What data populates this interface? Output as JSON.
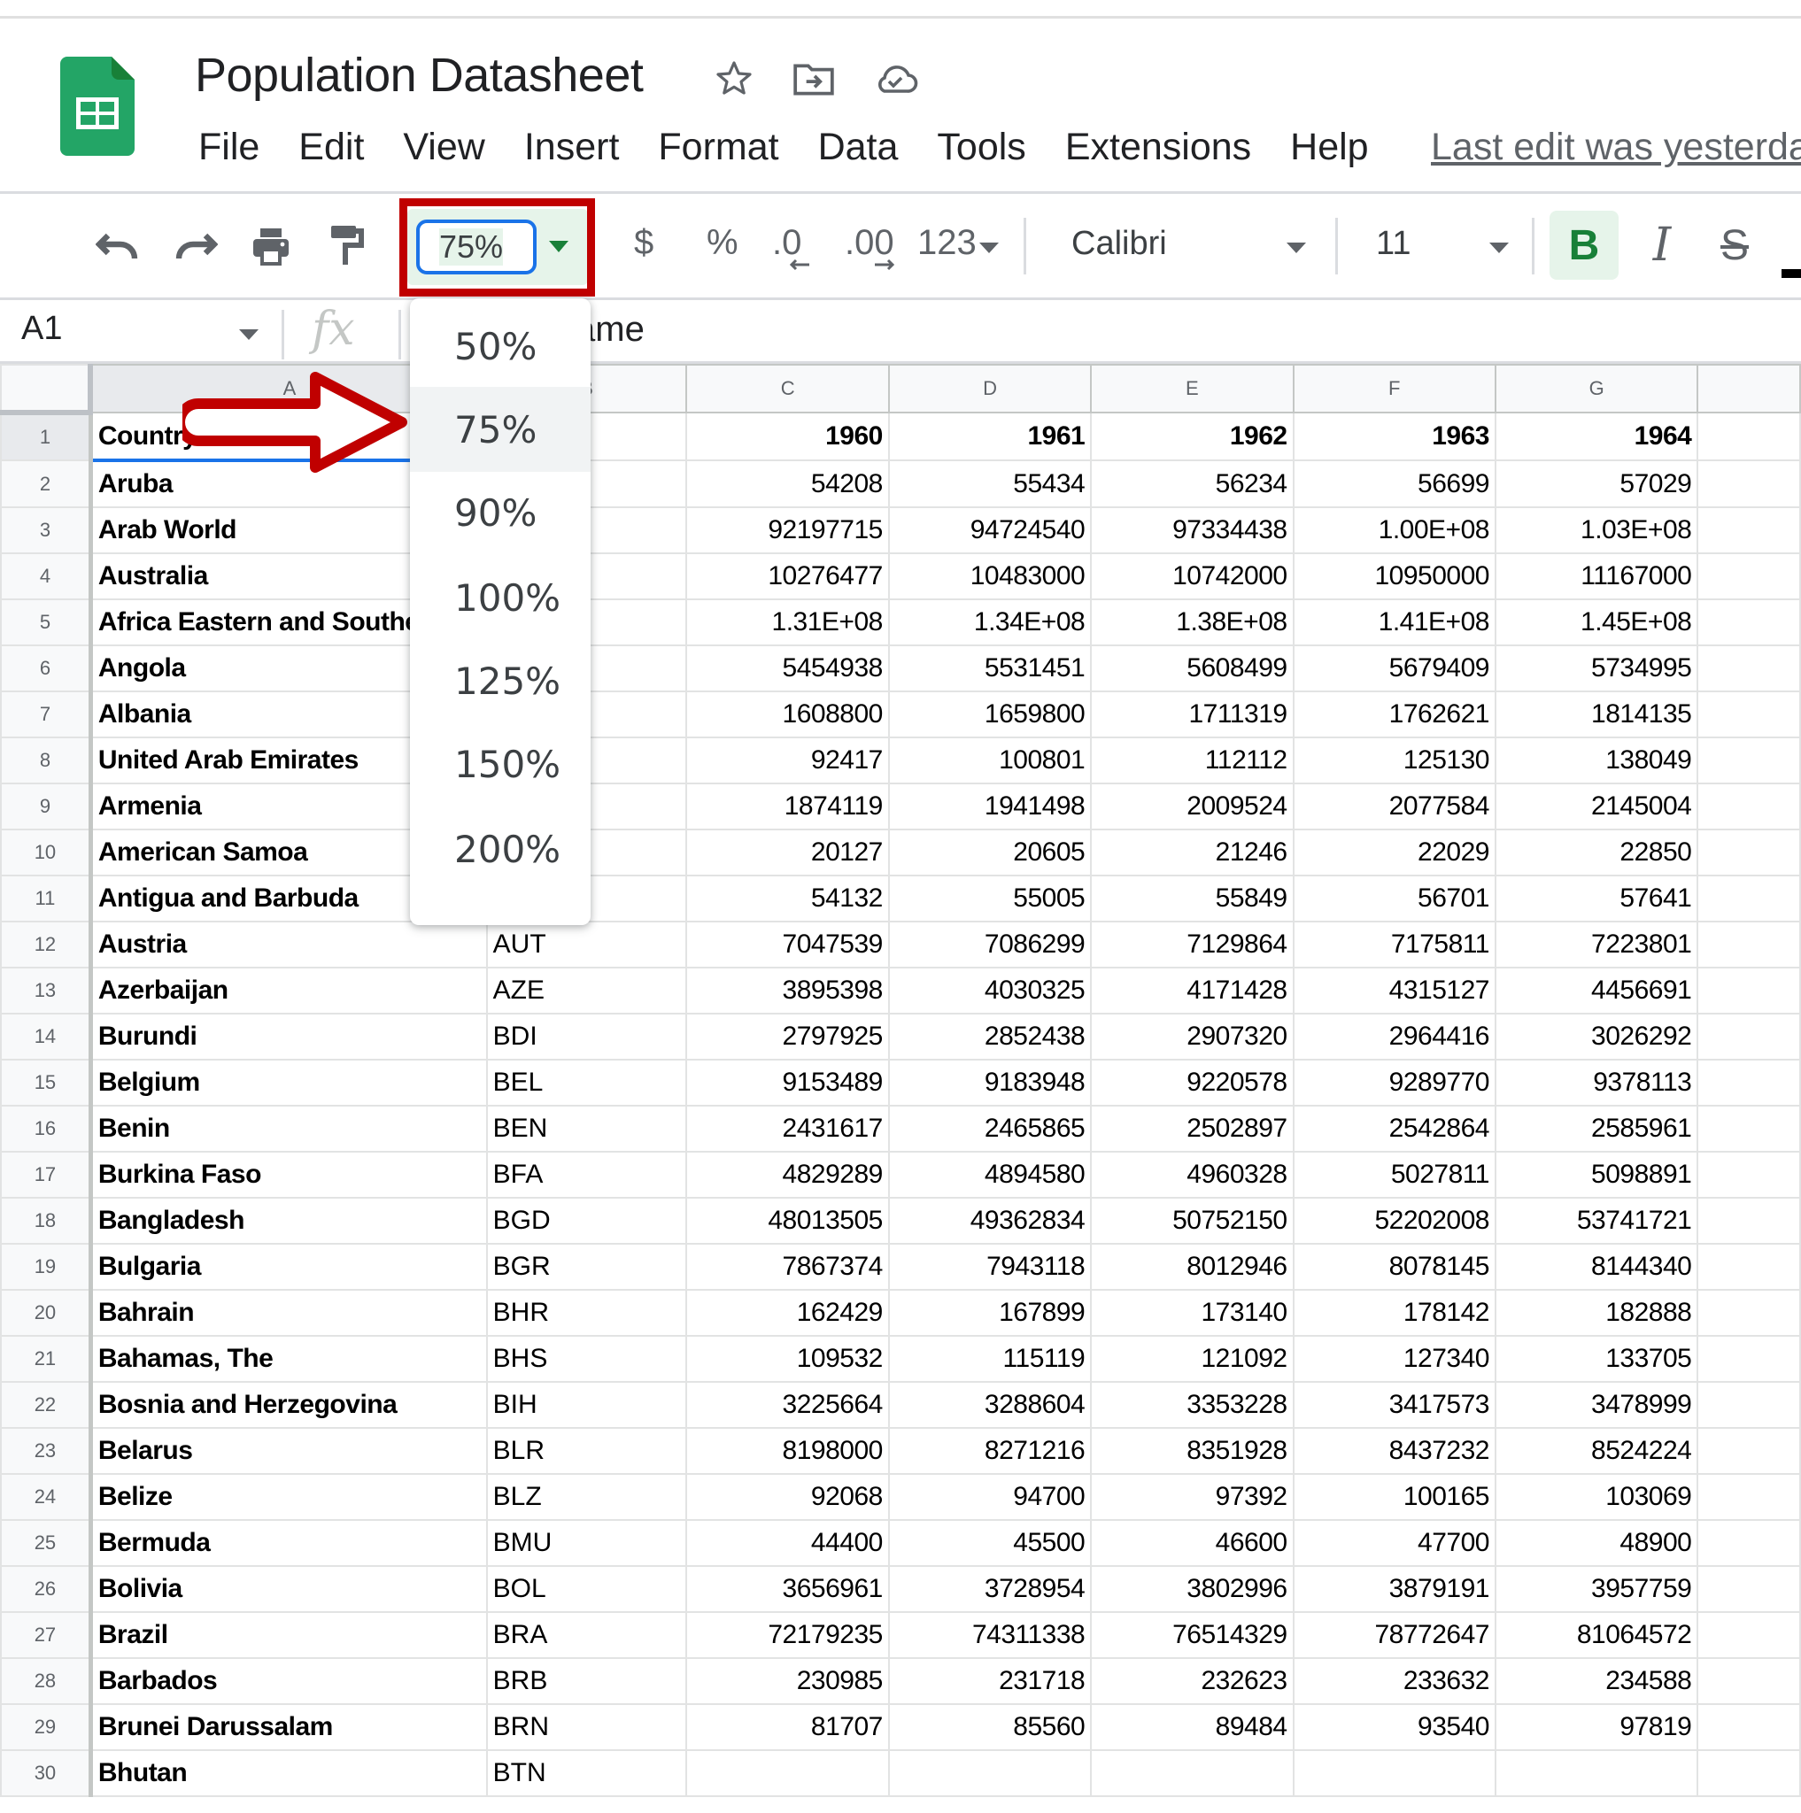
{
  "app": {
    "title": "Population Datasheet",
    "menu": [
      "File",
      "Edit",
      "View",
      "Insert",
      "Format",
      "Data",
      "Tools",
      "Extensions",
      "Help"
    ],
    "last_edit": "Last edit was yesterday"
  },
  "toolbar": {
    "zoom_value": "75%",
    "currency": "$",
    "percent": "%",
    "decrease_decimal": ".0",
    "increase_decimal": ".00",
    "number_format": "123",
    "font": "Calibri",
    "font_size": "11",
    "bold": "B",
    "italic": "I",
    "strikethrough": "S",
    "icons": [
      "undo-icon",
      "redo-icon",
      "print-icon",
      "paint-format-icon"
    ]
  },
  "formula_bar": {
    "cell_ref": "A1",
    "fx": "fx",
    "content": "Country Name"
  },
  "zoom_menu": {
    "options": [
      "50%",
      "75%",
      "90%",
      "100%",
      "125%",
      "150%",
      "200%"
    ],
    "selected": "75%"
  },
  "grid": {
    "columns": [
      "A",
      "B",
      "C",
      "D",
      "E",
      "F",
      "G",
      ""
    ],
    "rows": [
      {
        "n": "1",
        "name": "Country Name",
        "code": "",
        "v": [
          "1960",
          "1961",
          "1962",
          "1963",
          "1964"
        ]
      },
      {
        "n": "2",
        "name": "Aruba",
        "code": "",
        "v": [
          "54208",
          "55434",
          "56234",
          "56699",
          "57029"
        ]
      },
      {
        "n": "3",
        "name": "Arab World",
        "code": "",
        "v": [
          "92197715",
          "94724540",
          "97334438",
          "1.00E+08",
          "1.03E+08"
        ]
      },
      {
        "n": "4",
        "name": "Australia",
        "code": "",
        "v": [
          "10276477",
          "10483000",
          "10742000",
          "10950000",
          "11167000"
        ]
      },
      {
        "n": "5",
        "name": "Africa Eastern and Southern",
        "code": "",
        "v": [
          "1.31E+08",
          "1.34E+08",
          "1.38E+08",
          "1.41E+08",
          "1.45E+08"
        ]
      },
      {
        "n": "6",
        "name": "Angola",
        "code": "",
        "v": [
          "5454938",
          "5531451",
          "5608499",
          "5679409",
          "5734995"
        ]
      },
      {
        "n": "7",
        "name": "Albania",
        "code": "",
        "v": [
          "1608800",
          "1659800",
          "1711319",
          "1762621",
          "1814135"
        ]
      },
      {
        "n": "8",
        "name": "United Arab Emirates",
        "code": "",
        "v": [
          "92417",
          "100801",
          "112112",
          "125130",
          "138049"
        ]
      },
      {
        "n": "9",
        "name": "Armenia",
        "code": "",
        "v": [
          "1874119",
          "1941498",
          "2009524",
          "2077584",
          "2145004"
        ]
      },
      {
        "n": "10",
        "name": "American Samoa",
        "code": "",
        "v": [
          "20127",
          "20605",
          "21246",
          "22029",
          "22850"
        ]
      },
      {
        "n": "11",
        "name": "Antigua and Barbuda",
        "code": "",
        "v": [
          "54132",
          "55005",
          "55849",
          "56701",
          "57641"
        ]
      },
      {
        "n": "12",
        "name": "Austria",
        "code": "AUT",
        "v": [
          "7047539",
          "7086299",
          "7129864",
          "7175811",
          "7223801"
        ]
      },
      {
        "n": "13",
        "name": "Azerbaijan",
        "code": "AZE",
        "v": [
          "3895398",
          "4030325",
          "4171428",
          "4315127",
          "4456691"
        ]
      },
      {
        "n": "14",
        "name": "Burundi",
        "code": "BDI",
        "v": [
          "2797925",
          "2852438",
          "2907320",
          "2964416",
          "3026292"
        ]
      },
      {
        "n": "15",
        "name": "Belgium",
        "code": "BEL",
        "v": [
          "9153489",
          "9183948",
          "9220578",
          "9289770",
          "9378113"
        ]
      },
      {
        "n": "16",
        "name": "Benin",
        "code": "BEN",
        "v": [
          "2431617",
          "2465865",
          "2502897",
          "2542864",
          "2585961"
        ]
      },
      {
        "n": "17",
        "name": "Burkina Faso",
        "code": "BFA",
        "v": [
          "4829289",
          "4894580",
          "4960328",
          "5027811",
          "5098891"
        ]
      },
      {
        "n": "18",
        "name": "Bangladesh",
        "code": "BGD",
        "v": [
          "48013505",
          "49362834",
          "50752150",
          "52202008",
          "53741721"
        ]
      },
      {
        "n": "19",
        "name": "Bulgaria",
        "code": "BGR",
        "v": [
          "7867374",
          "7943118",
          "8012946",
          "8078145",
          "8144340"
        ]
      },
      {
        "n": "20",
        "name": "Bahrain",
        "code": "BHR",
        "v": [
          "162429",
          "167899",
          "173140",
          "178142",
          "182888"
        ]
      },
      {
        "n": "21",
        "name": "Bahamas, The",
        "code": "BHS",
        "v": [
          "109532",
          "115119",
          "121092",
          "127340",
          "133705"
        ]
      },
      {
        "n": "22",
        "name": "Bosnia and Herzegovina",
        "code": "BIH",
        "v": [
          "3225664",
          "3288604",
          "3353228",
          "3417573",
          "3478999"
        ]
      },
      {
        "n": "23",
        "name": "Belarus",
        "code": "BLR",
        "v": [
          "8198000",
          "8271216",
          "8351928",
          "8437232",
          "8524224"
        ]
      },
      {
        "n": "24",
        "name": "Belize",
        "code": "BLZ",
        "v": [
          "92068",
          "94700",
          "97392",
          "100165",
          "103069"
        ]
      },
      {
        "n": "25",
        "name": "Bermuda",
        "code": "BMU",
        "v": [
          "44400",
          "45500",
          "46600",
          "47700",
          "48900"
        ]
      },
      {
        "n": "26",
        "name": "Bolivia",
        "code": "BOL",
        "v": [
          "3656961",
          "3728954",
          "3802996",
          "3879191",
          "3957759"
        ]
      },
      {
        "n": "27",
        "name": "Brazil",
        "code": "BRA",
        "v": [
          "72179235",
          "74311338",
          "76514329",
          "78772647",
          "81064572"
        ]
      },
      {
        "n": "28",
        "name": "Barbados",
        "code": "BRB",
        "v": [
          "230985",
          "231718",
          "232623",
          "233632",
          "234588"
        ]
      },
      {
        "n": "29",
        "name": "Brunei Darussalam",
        "code": "BRN",
        "v": [
          "81707",
          "85560",
          "89484",
          "93540",
          "97819"
        ]
      },
      {
        "n": "30",
        "name": "Bhutan",
        "code": "BTN",
        "v": [
          "",
          "",
          "",
          "",
          ""
        ]
      }
    ]
  },
  "annotations": {
    "highlight_color": "#c00000",
    "accent_color": "#1a73e8",
    "brand_green": "#188038"
  }
}
